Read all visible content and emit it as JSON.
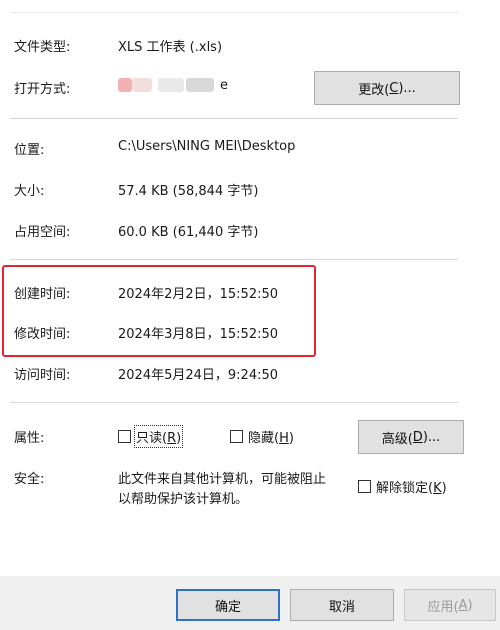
{
  "rows": {
    "file_type": {
      "label": "文件类型:",
      "value": "XLS 工作表 (.xls)"
    },
    "open_with": {
      "label": "打开方式:",
      "value_suffix": "e",
      "change_button": {
        "prefix": "更改(",
        "hotkey": "C",
        "suffix": ")..."
      }
    },
    "location": {
      "label": "位置:",
      "value": "C:\\Users\\NING MEI\\Desktop"
    },
    "size": {
      "label": "大小:",
      "value": "57.4 KB (58,844 字节)"
    },
    "size_on_disk": {
      "label": "占用空间:",
      "value": "60.0 KB (61,440 字节)"
    },
    "created": {
      "label": "创建时间:",
      "value": "2024年2月2日，15:52:50"
    },
    "modified": {
      "label": "修改时间:",
      "value": "2024年3月8日，15:52:50"
    },
    "accessed": {
      "label": "访问时间:",
      "value": "2024年5月24日，9:24:50"
    }
  },
  "attributes": {
    "label": "属性:",
    "readonly": {
      "prefix": "只读(",
      "hotkey": "R",
      "suffix": ")",
      "checked": false
    },
    "hidden": {
      "prefix": "隐藏(",
      "hotkey": "H",
      "suffix": ")",
      "checked": false
    },
    "advanced_button": {
      "prefix": "高级(",
      "hotkey": "D",
      "suffix": ")..."
    }
  },
  "security": {
    "label": "安全:",
    "line1": "此文件来自其他计算机，可能被阻止",
    "line2": "以帮助保护该计算机。",
    "unblock": {
      "prefix": "解除锁定(",
      "hotkey": "K",
      "suffix": ")",
      "checked": false
    }
  },
  "footer": {
    "ok_label": "确定",
    "cancel_label": "取消",
    "apply": {
      "prefix": "应用(",
      "hotkey": "A",
      "suffix": ")"
    }
  },
  "colors": {
    "highlight_border": "#e0262e",
    "primary_button_border": "#2c73c8"
  },
  "icons": {
    "open_with_app": "blurred-app-icon"
  }
}
